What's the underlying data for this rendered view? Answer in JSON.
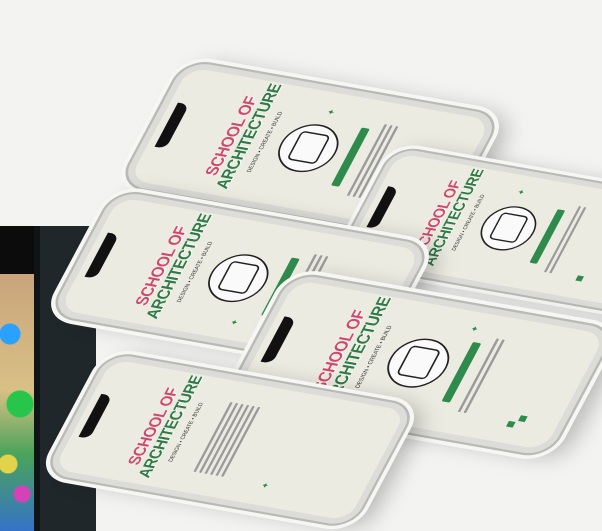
{
  "mockup": {
    "title_line1": "SCHOOL OF",
    "title_line2": "ARCHITECTURE",
    "subtitle": "DESIGN • CREATE • BUILD",
    "phones": [
      {
        "id": "p1",
        "variant": "yarn"
      },
      {
        "id": "p2",
        "variant": "building"
      },
      {
        "id": "p3",
        "variant": "box"
      },
      {
        "id": "p4",
        "variant": "tape"
      },
      {
        "id": "p5",
        "variant": "list"
      }
    ]
  }
}
